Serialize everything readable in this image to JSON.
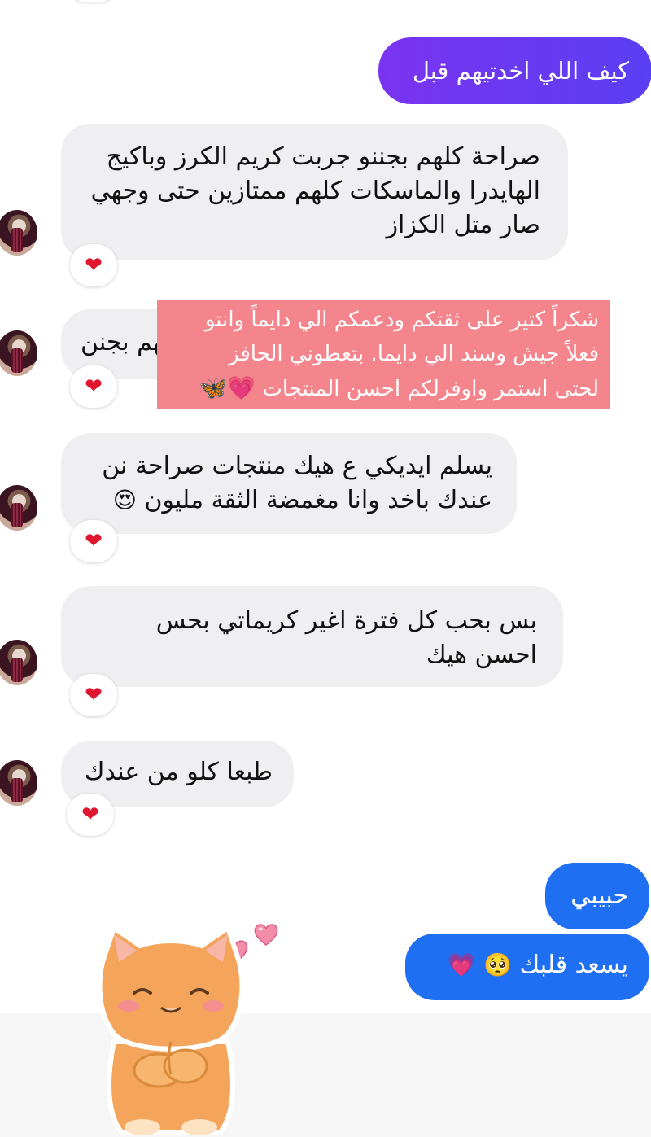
{
  "messages": {
    "m1": "كيف اللي اخدتيهم قبل",
    "m2": "صراحة كلهم بجننو جربت كريم الكرز وباكيج الهايدرا والماسكات كلهم ممتازين حتى وجهي صار متل الكزاز",
    "m3": "كلهم بجنن",
    "m4": "يسلم ايديكي ع هيك منتجات صراحة نن عندك باخد وانا مغمضة الثقة مليون",
    "m5": "بس بحب كل فترة اغير كريماتي بحس احسن هيك",
    "m6": "طبعا كلو من عندك",
    "m7": "حبيبي",
    "m8": "يسعد قلبك"
  },
  "emojis": {
    "heart_eyes": "😍",
    "pleading": "🥺",
    "growing_heart": "💗",
    "butterfly": "🦋",
    "reaction_heart": "❤"
  },
  "overlay_text": {
    "line1": "شكراً كتير على  ثقتكم ودعمكم الي دايماً وانتو",
    "line2": "فعلاً جيش وسند الي دايما. بتعطوني الحافز",
    "line3": "لحتى استمر واوفرلكم احسن المنتجات"
  },
  "colors": {
    "sent_purple": "#6a3af2",
    "sent_blue": "#1f6ff2",
    "received_bg": "#efeff1",
    "overlay_bg": "#f4858d",
    "reaction_heart": "#e0152f"
  }
}
